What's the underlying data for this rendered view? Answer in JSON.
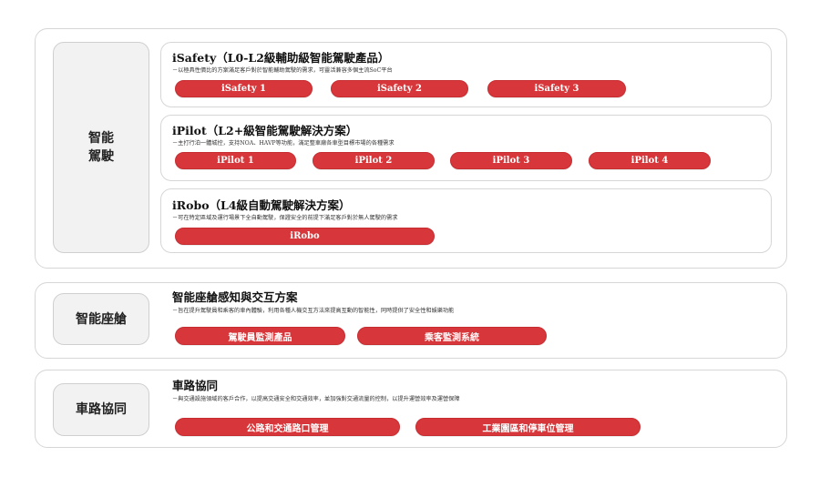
{
  "autonomous": {
    "side_label_1": "智能",
    "side_label_2": "駕駛",
    "isafety": {
      "title": "iSafety（L0-L2級輔助級智能駕駛產品）",
      "desc": "－以極具性價比的方案滿足客戶對於智能輔助駕駛的需求，可靈活兼容多個主流SoC平台",
      "buttons": [
        "iSafety 1",
        "iSafety 2",
        "iSafety 3"
      ]
    },
    "ipilot": {
      "title": "iPilot（L2+級智能駕駛解決方案）",
      "desc": "－主打行泊一體城控，支持NOA、HAVP等功能，滿足整車廠各車型目標市場的各種需求",
      "buttons": [
        "iPilot 1",
        "iPilot 2",
        "iPilot 3",
        "iPilot 4"
      ]
    },
    "irobo": {
      "title": "iRobo（L4級自動駕駛解決方案）",
      "desc": "－可在特定區域及運行場景下全自動駕駛，保證安全的前提下滿足客戶對於無人駕駛的需求",
      "buttons": [
        "iRobo"
      ]
    }
  },
  "cockpit": {
    "side_label": "智能座艙",
    "title": "智能座艙感知與交互方案",
    "desc": "－旨在提升駕駛員和乘客的車內體驗，利用各種人機交互方法來提高互動的智能性，同時提供了安全性和娛樂功能",
    "buttons": [
      "駕駛員監測產品",
      "乘客監測系統"
    ]
  },
  "v2x": {
    "side_label": "車路協同",
    "title": "車路協同",
    "desc": "－與交通設施領域的客戶合作，以提高交通安全和交通效率，並加強對交通流量的控制，以提升運營效率及運營保障",
    "buttons": [
      "公路和交通路口管理",
      "工業園區和停車位管理"
    ]
  },
  "colors": {
    "accent": "#d7373a",
    "border": "#d6d6d6",
    "side_bg": "#f2f2f2"
  }
}
